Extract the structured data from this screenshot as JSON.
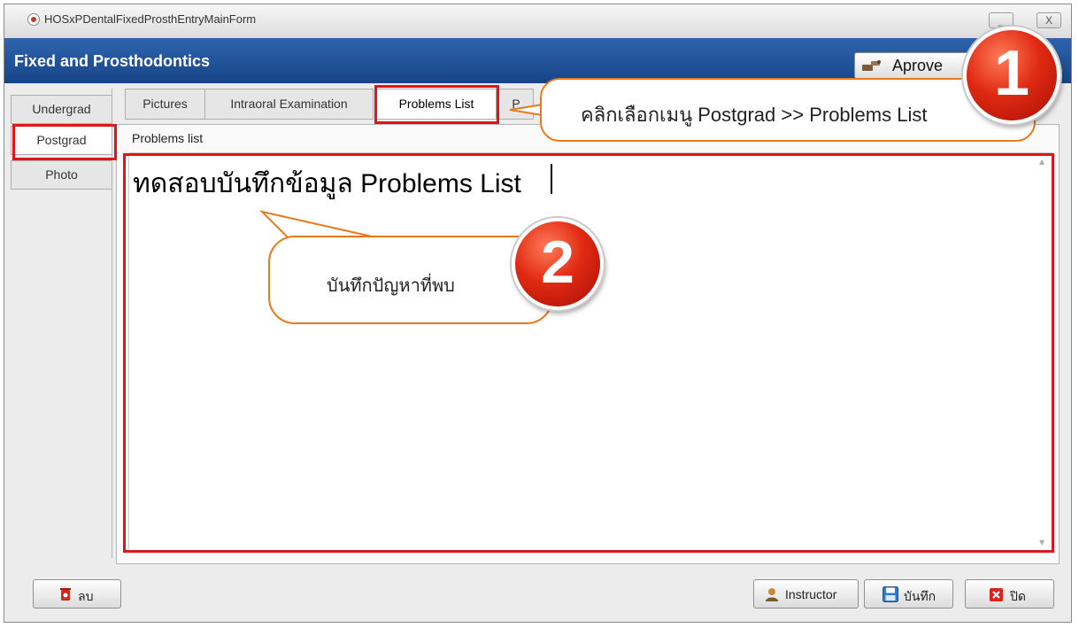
{
  "window": {
    "title": "HOSxPDentalFixedProsthEntryMainForm",
    "minimize_glyph": "_",
    "close_glyph": "X"
  },
  "header": {
    "title": "Fixed and Prosthodontics",
    "approve_label": "Aprove",
    "approve_icon": "stamp-icon"
  },
  "side_tabs": [
    {
      "label": "Undergrad"
    },
    {
      "label": "Postgrad"
    },
    {
      "label": "Photo"
    }
  ],
  "top_tabs": [
    {
      "label": "Pictures"
    },
    {
      "label": "Intraoral Examination"
    },
    {
      "label": "Problems List"
    },
    {
      "label": "P"
    }
  ],
  "panel": {
    "group_label": "Problems list",
    "memo_text": "ทดสอบบันทึกข้อมูล Problems List"
  },
  "bottom_buttons": {
    "delete_label": "ลบ",
    "instructor_label": "Instructor",
    "save_label": "บันทึก",
    "close_label": "ปิด"
  },
  "annotations": {
    "callout_1_text": "คลิกเลือกเมนู Postgrad >> Problems List",
    "badge_1": "1",
    "callout_2_text": "บันทึกปัญหาที่พบ",
    "badge_2": "2"
  },
  "colors": {
    "header_blue": "#1f4f97",
    "highlight_red": "#e0141b",
    "callout_orange": "#e87a1c",
    "badge_red": "#e02a12"
  }
}
